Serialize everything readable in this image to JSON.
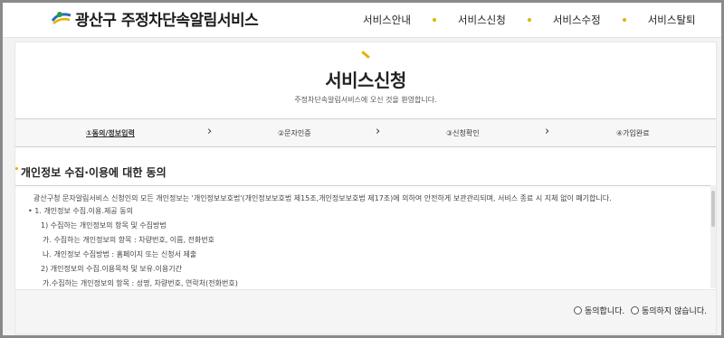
{
  "header": {
    "logo_text": "광산구 주정차단속알림서비스",
    "nav": [
      "서비스안내",
      "서비스신청",
      "서비스수정",
      "서비스탈퇴"
    ]
  },
  "page": {
    "title": "서비스신청",
    "subtitle": "주정차단속알림서비스에 오신 것을 환영합니다."
  },
  "steps": [
    "①동의/정보입력",
    "②문자인증",
    "③신청확인",
    "④가입완료"
  ],
  "section": {
    "title": "개인정보 수집·이용에 대한 동의"
  },
  "terms": [
    "광산구청 문자알림서비스 신청인의 모든 개인정보는 '개인정보보호법'(개인정보보호법 제15조,개인정보보호법 제17조)에 의하여 안전하게 보관관리되며, 서비스 종료 시 지체 없이 폐기합니다.",
    "•  1. 개인정보 수집.이용.제공 동의",
    "1) 수집하는 개인정보의 항목 및 수집방법",
    "가. 수집하는 개인정보의 항목 : 차량번호, 이름, 전화번호",
    "나. 개인정보 수집방법 : 홈페이지 또는 신청서 제출",
    "2) 개인정보의 수집.이용목적 및 보유.이용기간",
    "가.수집하는 개인정보의 항목 : 성명, 차량번호, 연락처(전화번호)"
  ],
  "agree": {
    "yes_label": "동의합니다.",
    "no_label": "동의하지 않습니다."
  },
  "colors": {
    "accent": "#e2b400",
    "border": "#8a8a8a"
  }
}
